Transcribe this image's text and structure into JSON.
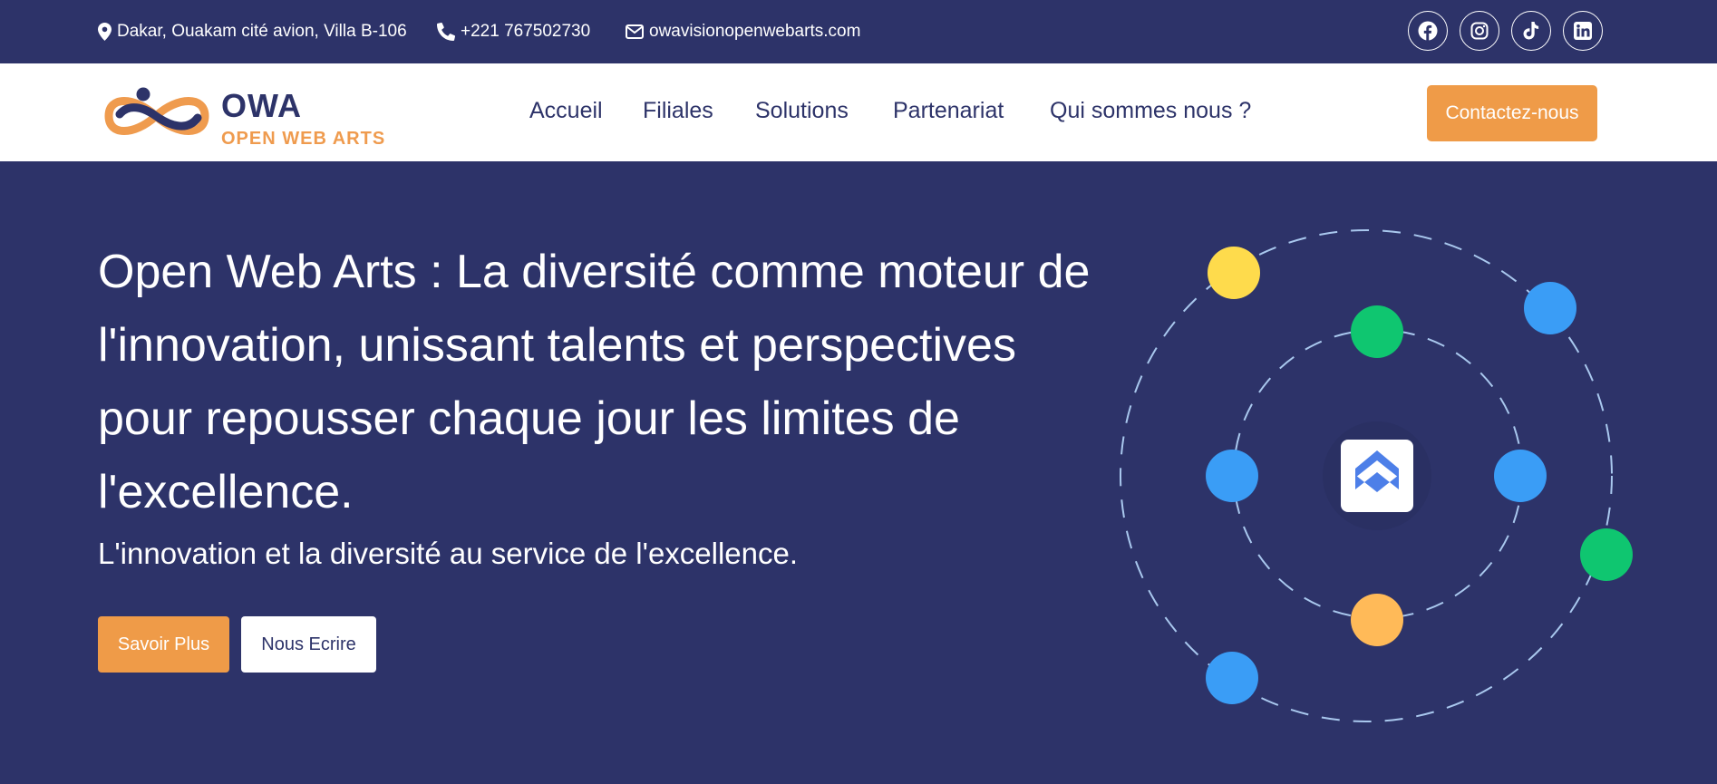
{
  "topbar": {
    "address": "Dakar, Ouakam cité avion, Villa B-106",
    "phone": "+221 767502730",
    "email": "owavisionopenwebarts.com",
    "social_icons": [
      "facebook-icon",
      "instagram-icon",
      "tiktok-icon",
      "linkedin-icon"
    ]
  },
  "brand": {
    "name": "OWA",
    "tagline": "OPEN WEB ARTS"
  },
  "nav": {
    "items": [
      "Accueil",
      "Filiales",
      "Solutions",
      "Partenariat",
      "Qui sommes nous ?"
    ],
    "cta": "Contactez-nous"
  },
  "hero": {
    "title": "Open Web Arts : La diversité comme moteur de l'innovation, unissant talents et perspectives pour repousser chaque jour les limites de l'excellence.",
    "subtitle": "L'innovation et la diversité au service de l'excellence.",
    "primary_button": "Savoir Plus",
    "secondary_button": "Nous Ecrire"
  },
  "colors": {
    "navy": "#2d3369",
    "orange": "#ef9b48",
    "blue_dot": "#3a9df6",
    "green_dot": "#0fc670",
    "yellow_dot": "#fedb4c",
    "light_orange_dot": "#ffba58"
  }
}
